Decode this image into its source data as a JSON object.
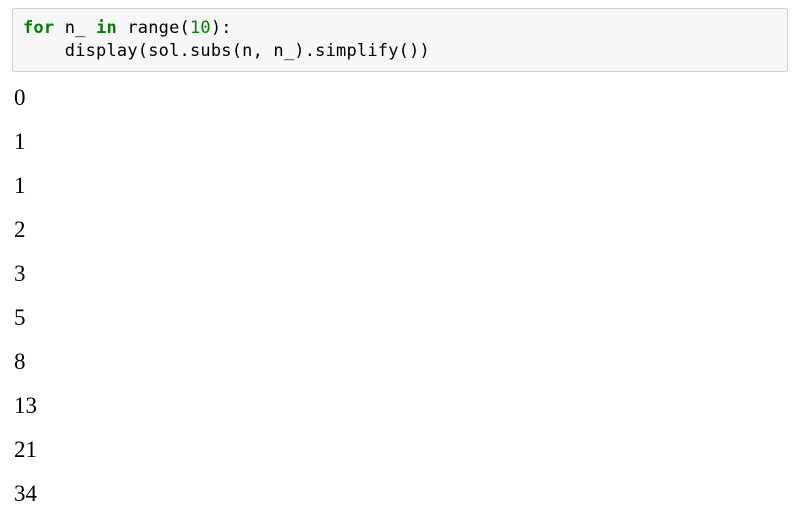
{
  "code": {
    "kw_for": "for",
    "var1": " n_ ",
    "kw_in": "in",
    "fn_range": " range(",
    "num_10": "10",
    "close_colon": "):",
    "line2": "    display(sol.subs(n, n_).simplify())"
  },
  "output_lines": [
    "0",
    "1",
    "1",
    "2",
    "3",
    "5",
    "8",
    "13",
    "21",
    "34"
  ]
}
